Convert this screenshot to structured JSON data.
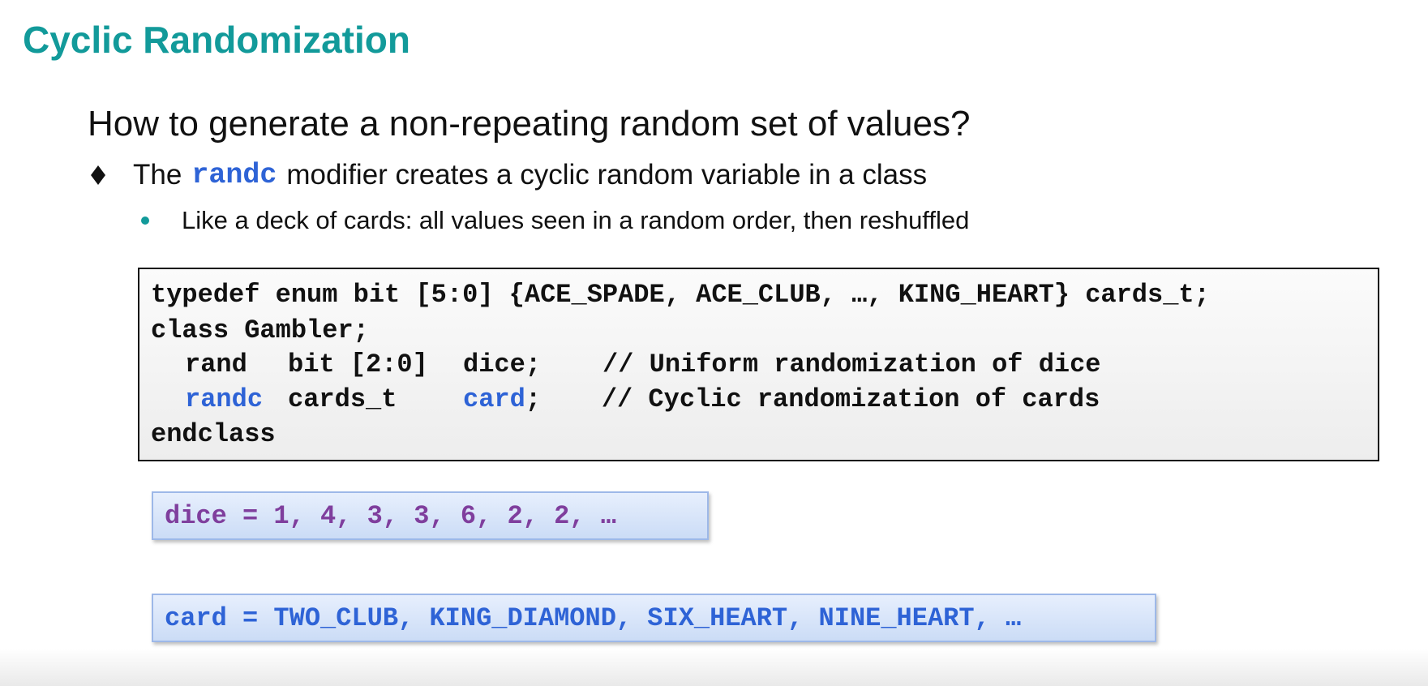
{
  "slide": {
    "title": "Cyclic Randomization",
    "heading": "How to generate a non-repeating random set of values?",
    "bullet": {
      "before": "The",
      "keyword": "randc",
      "after": "modifier creates a cyclic random variable in a class"
    },
    "sub_bullet": "Like a deck of cards: all values seen in a random order, then reshuffled",
    "code": {
      "line1": "typedef enum bit [5:0] {ACE_SPADE, ACE_CLUB, …, KING_HEART} cards_t;",
      "line2": "class Gambler;",
      "line3": {
        "kw": "rand",
        "type": "bit [2:0]",
        "name": "dice;",
        "comment": "// Uniform randomization of dice"
      },
      "line4": {
        "kw": "randc",
        "type": "cards_t",
        "name": "card",
        "semi": ";",
        "comment": "// Cyclic randomization of cards"
      },
      "line5": "endclass"
    },
    "dice_sequence": "dice = 1, 4, 3, 3, 6, 2, 2, …",
    "card_sequence": "card = TWO_CLUB, KING_DIAMOND, SIX_HEART, NINE_HEART, …"
  },
  "colors": {
    "title": "#129a9a",
    "keyword": "#2e63d6",
    "dice_text": "#7f3e9d",
    "bullet_marker": "#129a9a"
  },
  "icons": {
    "bullet": "diamond-bullet-icon",
    "sub_bullet": "round-dot-icon"
  }
}
